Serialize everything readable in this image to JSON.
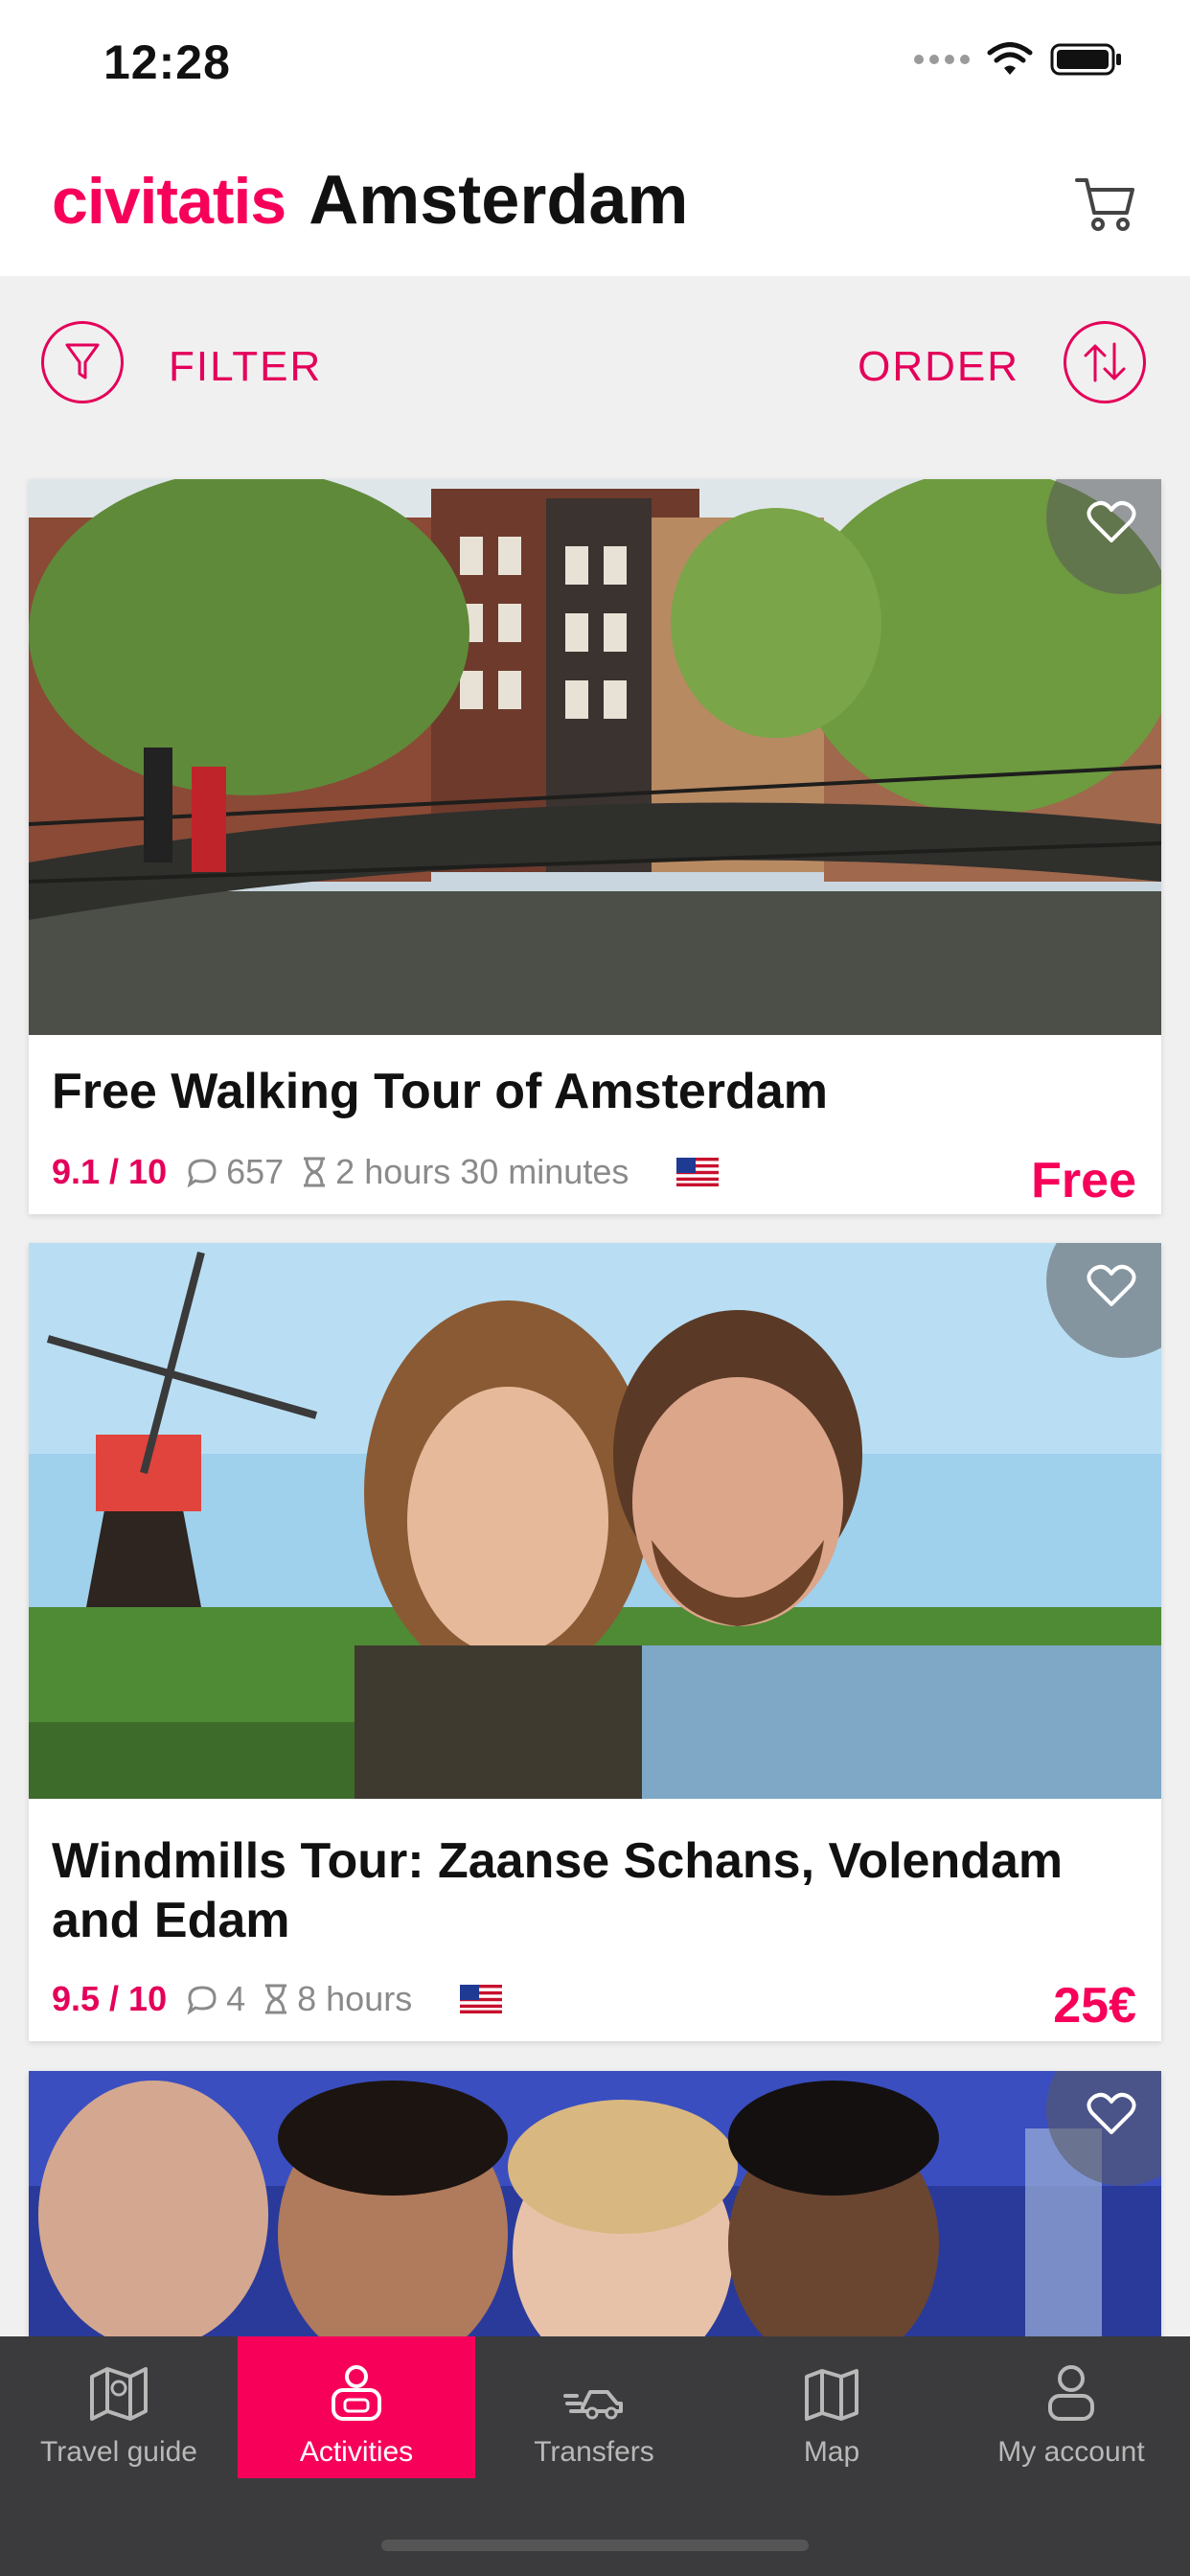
{
  "status_bar": {
    "time": "12:28"
  },
  "header": {
    "logo": "civitatis",
    "city": "Amsterdam"
  },
  "toolbar": {
    "filter_label": "FILTER",
    "order_label": "ORDER"
  },
  "activities": [
    {
      "title": "Free Walking Tour of Amsterdam",
      "rating": "9.1 / 10",
      "reviews": "657",
      "duration": "2 hours 30 minutes",
      "price": "Free"
    },
    {
      "title": "Windmills Tour: Zaanse Schans, Volendam and Edam",
      "rating": "9.5 / 10",
      "reviews": "4",
      "duration": "8 hours",
      "price": "25€"
    }
  ],
  "tabs": [
    {
      "label": "Travel guide",
      "icon": "map-fold-icon"
    },
    {
      "label": "Activities",
      "icon": "activities-icon"
    },
    {
      "label": "Transfers",
      "icon": "car-icon"
    },
    {
      "label": "Map",
      "icon": "map-icon"
    },
    {
      "label": "My account",
      "icon": "user-icon"
    }
  ],
  "colors": {
    "accent": "#f7005a",
    "tabbar": "#3b3b3d"
  }
}
